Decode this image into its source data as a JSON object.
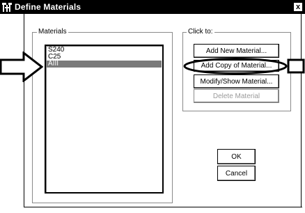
{
  "window": {
    "title": "Define Materials",
    "close_glyph": "x"
  },
  "materials_group": {
    "legend": "Materials",
    "items": [
      {
        "label": "S240",
        "selected": false
      },
      {
        "label": "C25",
        "selected": false
      },
      {
        "label": "AIII",
        "selected": true
      }
    ]
  },
  "click_to_group": {
    "legend": "Click to:",
    "buttons": {
      "add_new": "Add New Material...",
      "add_copy": "Add Copy of Material...",
      "modify_show": "Modify/Show Material...",
      "delete": "Delete Material"
    }
  },
  "dialog_buttons": {
    "ok": "OK",
    "cancel": "Cancel"
  },
  "annotations": {
    "left_arrow_icon": "hollow-arrow-right",
    "right_arrow_icon": "hollow-arrow-right",
    "highlight_ellipse_target": "add_copy"
  }
}
